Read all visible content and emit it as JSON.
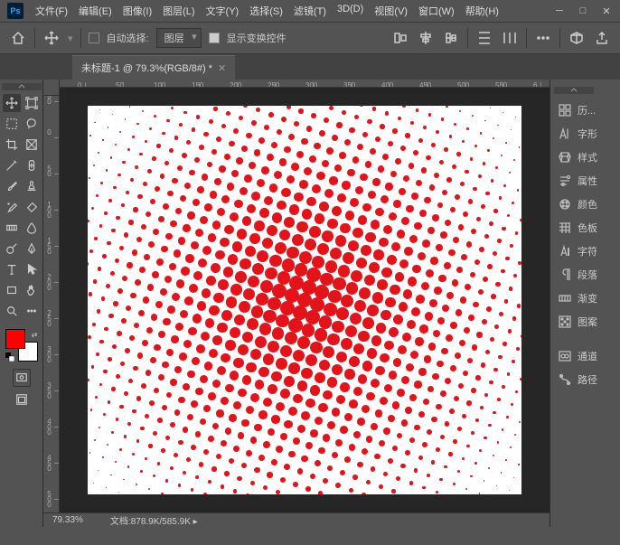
{
  "menu": [
    "文件(F)",
    "编辑(E)",
    "图像(I)",
    "图层(L)",
    "文字(Y)",
    "选择(S)",
    "滤镜(T)",
    "3D(D)",
    "视图(V)",
    "窗口(W)",
    "帮助(H)"
  ],
  "optbar": {
    "auto_select": "自动选择:",
    "select_target": "图层",
    "show_transform": "显示变换控件"
  },
  "tab": {
    "title": "未标题-1 @ 79.3%(RGB/8#) *"
  },
  "ruler_h": [
    "0",
    "50",
    "100",
    "150",
    "200",
    "250",
    "300",
    "350",
    "400",
    "450",
    "500",
    "550",
    "6"
  ],
  "ruler_v": [
    "50",
    "0",
    "50",
    "100",
    "150",
    "200",
    "250",
    "300",
    "350",
    "400",
    "450",
    "500"
  ],
  "status": {
    "zoom": "79.33%",
    "doc_label": "文档:",
    "doc_size": "878.9K/585.9K"
  },
  "panels": [
    "历...",
    "字形",
    "样式",
    "属性",
    "颜色",
    "色板",
    "字符",
    "段落",
    "渐变",
    "图案"
  ],
  "panels2": [
    "通道",
    "路径"
  ],
  "colors": {
    "fg": "#ff0000",
    "bg": "#ffffff"
  }
}
